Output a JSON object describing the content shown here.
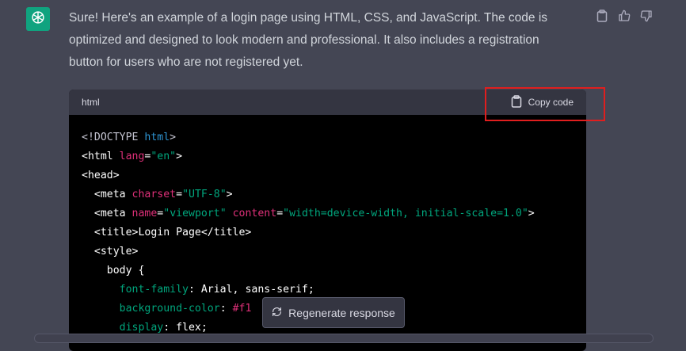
{
  "assistant": {
    "avatar_icon": "openai-logo-icon",
    "message": "Sure! Here's an example of a login page using HTML, CSS, and JavaScript. The code is optimized and designed to look modern and professional. It also includes a registration button for users who are not registered yet."
  },
  "message_actions": [
    {
      "name": "copy-message-icon"
    },
    {
      "name": "thumbs-up-icon"
    },
    {
      "name": "thumbs-down-icon"
    }
  ],
  "code_block": {
    "language": "html",
    "copy_label": "Copy code",
    "lines": [
      [
        {
          "t": "<!DOCTYPE ",
          "c": "c-gray"
        },
        {
          "t": "html",
          "c": "c-blue"
        },
        {
          "t": ">",
          "c": "c-gray"
        }
      ],
      [
        {
          "t": "<html ",
          "c": "c-white"
        },
        {
          "t": "lang",
          "c": "c-red"
        },
        {
          "t": "=",
          "c": "c-white"
        },
        {
          "t": "\"en\"",
          "c": "c-green"
        },
        {
          "t": ">",
          "c": "c-white"
        }
      ],
      [
        {
          "t": "<head>",
          "c": "c-white"
        }
      ],
      [
        {
          "t": "  <meta ",
          "c": "c-white"
        },
        {
          "t": "charset",
          "c": "c-red"
        },
        {
          "t": "=",
          "c": "c-white"
        },
        {
          "t": "\"UTF-8\"",
          "c": "c-green"
        },
        {
          "t": ">",
          "c": "c-white"
        }
      ],
      [
        {
          "t": "  <meta ",
          "c": "c-white"
        },
        {
          "t": "name",
          "c": "c-red"
        },
        {
          "t": "=",
          "c": "c-white"
        },
        {
          "t": "\"viewport\"",
          "c": "c-green"
        },
        {
          "t": " ",
          "c": "c-white"
        },
        {
          "t": "content",
          "c": "c-red"
        },
        {
          "t": "=",
          "c": "c-white"
        },
        {
          "t": "\"width=device-width, initial-scale=1.0\"",
          "c": "c-green"
        },
        {
          "t": ">",
          "c": "c-white"
        }
      ],
      [
        {
          "t": "  <title>Login Page</title>",
          "c": "c-white"
        }
      ],
      [
        {
          "t": "  <style>",
          "c": "c-white"
        }
      ],
      [
        {
          "t": "    body {",
          "c": "c-white"
        }
      ],
      [
        {
          "t": "      ",
          "c": "c-white"
        },
        {
          "t": "font-family",
          "c": "c-green"
        },
        {
          "t": ": Arial, sans-serif;",
          "c": "c-white"
        }
      ],
      [
        {
          "t": "      ",
          "c": "c-white"
        },
        {
          "t": "background-color",
          "c": "c-green"
        },
        {
          "t": ": ",
          "c": "c-white"
        },
        {
          "t": "#f1",
          "c": "c-red"
        }
      ],
      [
        {
          "t": "      ",
          "c": "c-white"
        },
        {
          "t": "display",
          "c": "c-green"
        },
        {
          "t": ": flex;",
          "c": "c-white"
        }
      ]
    ]
  },
  "regenerate": {
    "label": "Regenerate response",
    "icon": "refresh-icon"
  }
}
